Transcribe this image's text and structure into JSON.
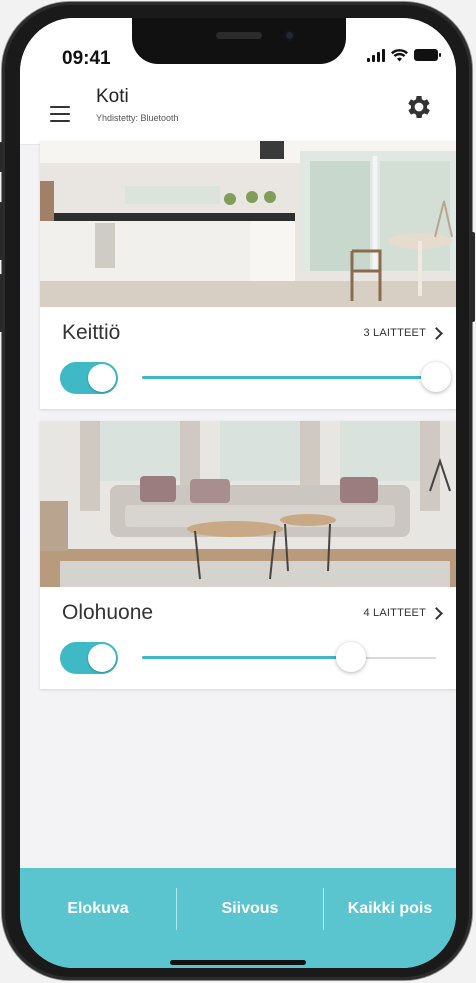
{
  "status_bar": {
    "time": "09:41"
  },
  "header": {
    "title": "Koti",
    "subtitle": "Yhdistetty: Bluetooth"
  },
  "rooms": [
    {
      "name": "Keittiö",
      "devices": "3 LAITTEET",
      "on": true,
      "brightness": 1.0
    },
    {
      "name": "Olohuone",
      "devices": "4 LAITTEET",
      "on": true,
      "brightness": 0.71
    }
  ],
  "scenes": [
    "Elokuva",
    "Siivous",
    "Kaikki pois"
  ],
  "colors": {
    "accent": "#3fb9c6",
    "bottom_bar": "#5ac5cf"
  },
  "icons": {
    "menu": "menu-icon",
    "settings": "gear-icon",
    "chevron": "chevron-right-icon"
  }
}
